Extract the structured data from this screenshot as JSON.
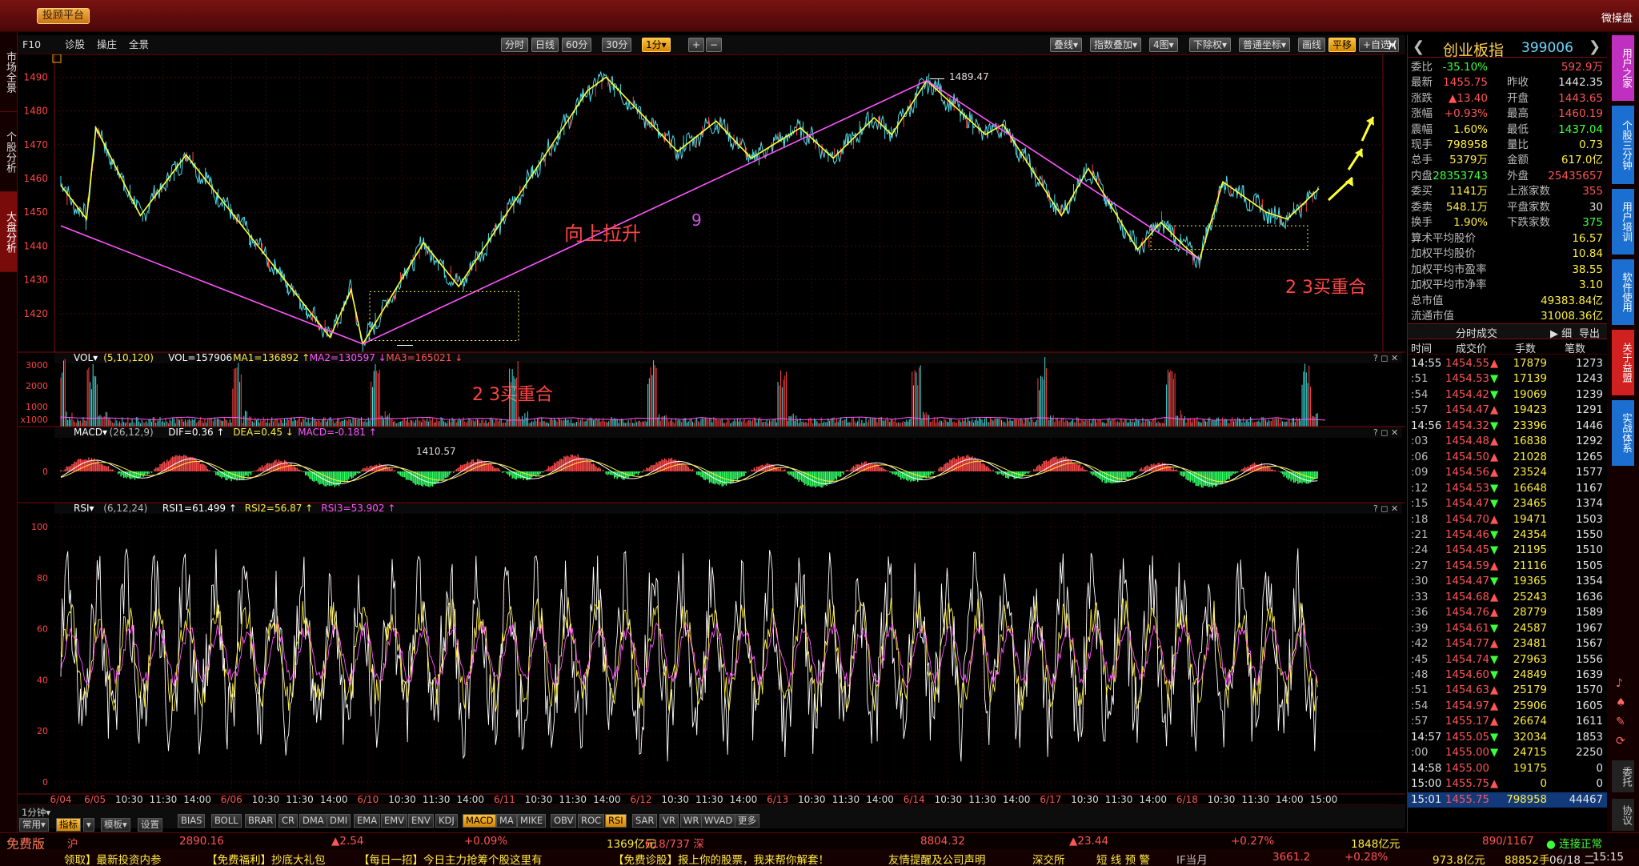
{
  "topbar": {
    "button": "投顾平台",
    "right": "微操盘"
  },
  "lefttabs": [
    "市场全景",
    "个股分析",
    "大盘分析"
  ],
  "toolbar": {
    "left": [
      "F10",
      "诊股",
      "操庄",
      "全景"
    ],
    "periods": [
      {
        "label": "分时"
      },
      {
        "label": "日线"
      },
      {
        "label": "60分"
      },
      {
        "label": "30分"
      },
      {
        "label": "1分▾",
        "on": true
      }
    ],
    "zoom": [
      "+",
      "−"
    ],
    "right": [
      {
        "label": "叠线▾"
      },
      {
        "label": "指数叠加▾"
      },
      {
        "label": "4图▾"
      },
      {
        "label": "下除权▾"
      },
      {
        "label": "普通坐标▾"
      },
      {
        "label": "画线"
      },
      {
        "label": "平移",
        "on": true
      },
      {
        "label": "+自选▾"
      }
    ]
  },
  "chart_data": {
    "type": "line",
    "title": "",
    "ylim": [
      1410,
      1492
    ],
    "yticks": [
      "1490",
      "1480",
      "1470",
      "1460",
      "1450",
      "1440",
      "1430",
      "1420"
    ],
    "xticks": [
      "6/04",
      "6/05",
      "10:30",
      "11:30",
      "14:00",
      "6/06",
      "10:30",
      "11:30",
      "14:00",
      "6/10",
      "10:30",
      "11:30",
      "14:00",
      "6/11",
      "10:30",
      "11:30",
      "14:00",
      "6/12",
      "10:30",
      "11:30",
      "14:00",
      "6/13",
      "10:30",
      "11:30",
      "14:00",
      "6/14",
      "10:30",
      "11:30",
      "14:00",
      "6/17",
      "10:30",
      "11:30",
      "14:00",
      "6/18",
      "10:30",
      "11:30",
      "14:00",
      "15:00"
    ],
    "annotations": [
      {
        "text": "向上拉升",
        "color": "#ff4444"
      },
      {
        "text": "9",
        "color": "#cc55dd"
      },
      {
        "text": "2 3买重合",
        "color": "#ff4444"
      },
      {
        "text": "2 3买重合",
        "color": "#ff4444"
      },
      {
        "text": "1489.47",
        "color": "#dddddd"
      },
      {
        "text": "1410.57",
        "color": "#dddddd"
      }
    ],
    "high_label": "1489.47",
    "low_label": "1410.57",
    "series": [],
    "pivots_yellow": [
      [
        0,
        1458
      ],
      [
        0.022,
        1448
      ],
      [
        0.03,
        1475
      ],
      [
        0.068,
        1449
      ],
      [
        0.107,
        1467
      ],
      [
        0.23,
        1413
      ],
      [
        0.248,
        1427
      ],
      [
        0.258,
        1411
      ],
      [
        0.31,
        1441
      ],
      [
        0.34,
        1428
      ],
      [
        0.45,
        1486
      ],
      [
        0.466,
        1490
      ],
      [
        0.527,
        1468
      ],
      [
        0.56,
        1477
      ],
      [
        0.59,
        1466
      ],
      [
        0.632,
        1475
      ],
      [
        0.66,
        1466
      ],
      [
        0.695,
        1478
      ],
      [
        0.71,
        1473
      ],
      [
        0.74,
        1489
      ],
      [
        0.79,
        1473
      ],
      [
        0.805,
        1476
      ],
      [
        0.855,
        1449
      ],
      [
        0.878,
        1463
      ],
      [
        0.92,
        1439
      ],
      [
        0.94,
        1447
      ],
      [
        0.96,
        1440
      ],
      [
        0.973,
        1436
      ],
      [
        0.993,
        1459
      ],
      [
        1.03,
        1450
      ],
      [
        1.048,
        1448
      ],
      [
        1.075,
        1457
      ]
    ],
    "pivots_magenta": [
      [
        0,
        1446
      ],
      [
        0.258,
        1411
      ],
      [
        0.74,
        1489
      ],
      [
        0.973,
        1436
      ]
    ]
  },
  "vol": {
    "header": "VOL",
    "params": "(5,10,120)",
    "v": "VOL=157906",
    "ma1": "MA1=136892",
    "ma2": "MA2=130597",
    "ma3": "MA3=165021",
    "yticks": [
      "3000",
      "2000",
      "1000",
      "x1000"
    ]
  },
  "macd": {
    "header": "MACD",
    "params": "(26,12,9)",
    "dif": "DIF=0.36",
    "dea": "DEA=0.45",
    "macd": "MACD=-0.181",
    "yticks": [
      "0"
    ]
  },
  "rsi": {
    "header": "RSI",
    "params": "(6,12,24)",
    "r1": "RSI1=61.499",
    "r2": "RSI2=56.87",
    "r3": "RSI3=53.902",
    "yticks": [
      "100",
      "80",
      "60",
      "40",
      "20",
      "0"
    ]
  },
  "right": {
    "title": {
      "name": "创业板指",
      "code": "399006",
      "prev": "❮",
      "next": "❯"
    },
    "quote": [
      [
        [
          "委比",
          "-35.10%",
          "grn"
        ],
        [
          "",
          "592.9万",
          "red"
        ]
      ],
      [
        [
          "最新",
          "1455.75",
          "red"
        ],
        [
          "昨收",
          "1442.35",
          "wht"
        ]
      ],
      [
        [
          "涨跌",
          "▲13.40",
          "red"
        ],
        [
          "开盘",
          "1443.65",
          "red"
        ]
      ],
      [
        [
          "涨幅",
          "+0.93%",
          "red"
        ],
        [
          "最高",
          "1460.19",
          "red"
        ]
      ],
      [
        [
          "震幅",
          "1.60%",
          "yel"
        ],
        [
          "最低",
          "1437.04",
          "grn"
        ]
      ],
      [
        [
          "现手",
          "798958",
          "yel"
        ],
        [
          "量比",
          "0.73",
          "yel"
        ]
      ],
      [
        [
          "总手",
          "5379万",
          "yel"
        ],
        [
          "金额",
          "617.0亿",
          "yel"
        ]
      ],
      [
        [
          "内盘",
          "28353743",
          "grn"
        ],
        [
          "外盘",
          "25435657",
          "red"
        ]
      ],
      [
        [
          "委买",
          "1141万",
          "yel"
        ],
        [
          "上涨家数",
          "355",
          "red"
        ]
      ],
      [
        [
          "委卖",
          "548.1万",
          "yel"
        ],
        [
          "平盘家数",
          "30",
          "wht"
        ]
      ],
      [
        [
          "换手",
          "1.90%",
          "yel"
        ],
        [
          "下跌家数",
          "375",
          "grn"
        ]
      ]
    ],
    "stats": [
      [
        "算术平均股价",
        "16.57"
      ],
      [
        "加权平均股价",
        "10.84"
      ],
      [
        "加权平均市盈率",
        "38.55"
      ],
      [
        "加权平均市净率",
        "3.10"
      ],
      [
        "总市值",
        "49383.84亿"
      ],
      [
        "流通市值",
        "31008.36亿"
      ]
    ],
    "fs": {
      "title": "分时成交",
      "detail": "▶ 细",
      "export": "导出",
      "head": [
        "时间",
        "成交价",
        "手数",
        "笔数"
      ]
    },
    "ticks": [
      [
        "14:55",
        "1454.55",
        "▲",
        "17879",
        "1273"
      ],
      [
        ":51",
        "1454.53",
        "▼",
        "17139",
        "1243"
      ],
      [
        ":54",
        "1454.42",
        "▼",
        "19069",
        "1239"
      ],
      [
        ":57",
        "1454.47",
        "▲",
        "19423",
        "1291"
      ],
      [
        "14:56",
        "1454.32",
        "▼",
        "23396",
        "1446"
      ],
      [
        ":03",
        "1454.48",
        "▲",
        "16838",
        "1292"
      ],
      [
        ":06",
        "1454.50",
        "▲",
        "21028",
        "1265"
      ],
      [
        ":09",
        "1454.56",
        "▲",
        "23524",
        "1577"
      ],
      [
        ":12",
        "1454.53",
        "▼",
        "16648",
        "1167"
      ],
      [
        ":15",
        "1454.47",
        "▼",
        "23465",
        "1374"
      ],
      [
        ":18",
        "1454.70",
        "▲",
        "19471",
        "1503"
      ],
      [
        ":21",
        "1454.46",
        "▼",
        "24354",
        "1550"
      ],
      [
        ":24",
        "1454.45",
        "▼",
        "21195",
        "1510"
      ],
      [
        ":27",
        "1454.59",
        "▲",
        "21116",
        "1505"
      ],
      [
        ":30",
        "1454.47",
        "▼",
        "19365",
        "1354"
      ],
      [
        ":33",
        "1454.68",
        "▲",
        "25243",
        "1636"
      ],
      [
        ":36",
        "1454.76",
        "▲",
        "28779",
        "1589"
      ],
      [
        ":39",
        "1454.61",
        "▼",
        "24587",
        "1967"
      ],
      [
        ":42",
        "1454.77",
        "▲",
        "23481",
        "1567"
      ],
      [
        ":45",
        "1454.74",
        "▼",
        "27963",
        "1556"
      ],
      [
        ":48",
        "1454.60",
        "▼",
        "24849",
        "1639"
      ],
      [
        ":51",
        "1454.63",
        "▲",
        "25179",
        "1570"
      ],
      [
        ":54",
        "1454.97",
        "▲",
        "25906",
        "1605"
      ],
      [
        ":57",
        "1455.17",
        "▲",
        "26674",
        "1611"
      ],
      [
        "14:57",
        "1455.05",
        "▼",
        "32034",
        "1853"
      ],
      [
        ":00",
        "1455.00",
        "▼",
        "24715",
        "2250"
      ],
      [
        "14:58",
        "1455.00",
        "",
        "19175",
        "0"
      ],
      [
        "15:00",
        "1455.75",
        "▲",
        "0",
        "0"
      ],
      [
        "15:01",
        "1455.75",
        "",
        "798958",
        "44467"
      ]
    ]
  },
  "rstrip": [
    {
      "label": "用户之家",
      "color": "#c030c0"
    },
    {
      "label": "个股三分钟",
      "color": "#1a6fd0"
    },
    {
      "label": "用户培训",
      "color": "#1a6fd0"
    },
    {
      "label": "软件使用",
      "color": "#1a6fd0"
    },
    {
      "label": "关于益盟",
      "color": "#d02020"
    },
    {
      "label": "实战体系",
      "color": "#1a6fd0"
    }
  ],
  "rstrip_bottom": [
    "委托",
    "协议"
  ],
  "bottom": {
    "left": [
      {
        "label": "1分钟▾"
      },
      {
        "label": "常用▾"
      },
      {
        "label": "指标",
        "on": true
      },
      {
        "label": "▾"
      },
      {
        "label": "模板▾"
      },
      {
        "label": "设置"
      }
    ],
    "ind": [
      "BIAS",
      "BOLL",
      "BRAR",
      "CR",
      "DMA",
      "DMI",
      "EMA",
      "EMV",
      "ENV",
      "KDJ",
      "MACD",
      "MA",
      "MIKE",
      "OBV",
      "ROC",
      "RSI",
      "SAR",
      "VR",
      "WR",
      "WVAD",
      "更多"
    ],
    "ind_on": [
      "MACD",
      "RSI"
    ]
  },
  "ticker1": [
    {
      "t": "免费版",
      "c": "#ff7755"
    },
    {
      "t": "沪",
      "c": "#ff5555"
    },
    {
      "t": "2890.16",
      "c": "#ff5555"
    },
    {
      "t": "▲2.54",
      "c": "#ff5555"
    },
    {
      "t": "+0.09%",
      "c": "#ff5555"
    },
    {
      "t": "1369亿元",
      "c": "#ffee44"
    },
    {
      "t": "618/737 深",
      "c": "#ff5555"
    },
    {
      "t": "8804.32",
      "c": "#ff5555"
    },
    {
      "t": "▲23.44",
      "c": "#ff5555"
    },
    {
      "t": "+0.27%",
      "c": "#ff5555"
    },
    {
      "t": "1848亿元",
      "c": "#ffee44"
    },
    {
      "t": "890/1167",
      "c": "#ff5555"
    },
    {
      "t": "● 连接正常",
      "c": "#3cff3c"
    }
  ],
  "ticker2": [
    {
      "t": "领取】最新投资内参",
      "c": "#ffee44"
    },
    {
      "t": "【免费福利】抄底大礼包",
      "c": "#ffee44"
    },
    {
      "t": "【每日一招】今日主力抢筹个股这里有",
      "c": "#ffee44"
    },
    {
      "t": "【免费诊股】报上你的股票，我来帮你解套！",
      "c": "#ffee44"
    },
    {
      "t": "友情提醒及公司声明",
      "c": "#ffee44"
    },
    {
      "t": "深交所",
      "c": "#ffee44"
    },
    {
      "t": "短 线 预 警",
      "c": "#ffee44"
    },
    {
      "t": "IF当月",
      "c": "#bbbbbb"
    },
    {
      "t": "3661.2",
      "c": "#ff5555"
    },
    {
      "t": "+0.28%",
      "c": "#ff5555"
    },
    {
      "t": "973.8亿元",
      "c": "#ffee44"
    },
    {
      "t": "88852手",
      "c": "#ffee44"
    },
    {
      "t": "06/18 二",
      "c": "#e6e6e6"
    },
    {
      "t": "15:15",
      "c": "#e6e6e6"
    }
  ]
}
